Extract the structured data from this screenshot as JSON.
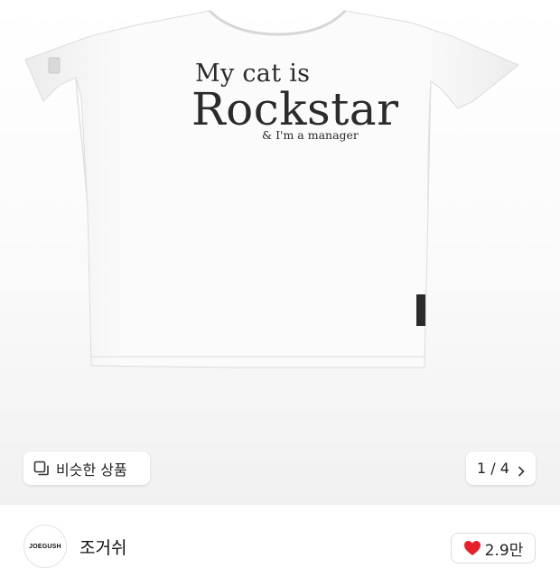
{
  "product": {
    "print_line1": "My cat is",
    "print_line2": "Rockstar",
    "print_line3": "& I'm a manager"
  },
  "similar_products": {
    "label": "비슷한 상품",
    "icon": "copy-icon"
  },
  "pagination": {
    "text": "1 / 4",
    "icon": "chevron-right-icon"
  },
  "seller": {
    "logo_text": "JOEGUSH",
    "name": "조거쉬"
  },
  "likes": {
    "count": "2.9만",
    "icon": "heart-icon",
    "heart_color": "#e8202b"
  }
}
